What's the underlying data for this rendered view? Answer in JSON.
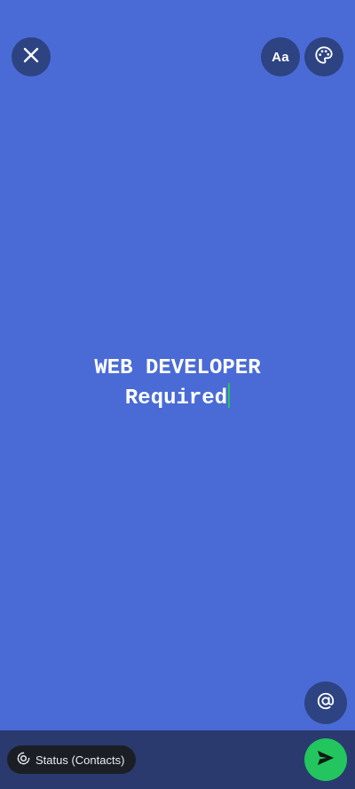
{
  "toolbar": {
    "font_button_label": "Aa"
  },
  "status": {
    "line1": "WEB DEVELOPER",
    "line2": "Required"
  },
  "footer": {
    "audience_label": "Status (Contacts)"
  },
  "icons": {
    "close": "close-icon",
    "palette": "palette-icon",
    "mention": "at-sign-icon",
    "status": "status-ring-icon",
    "send": "send-icon"
  },
  "colors": {
    "background": "#4a6bd6",
    "button": "#2d4382",
    "bottom_bar": "#2a3a6e",
    "send": "#22c55e",
    "caret": "#25c45a"
  }
}
